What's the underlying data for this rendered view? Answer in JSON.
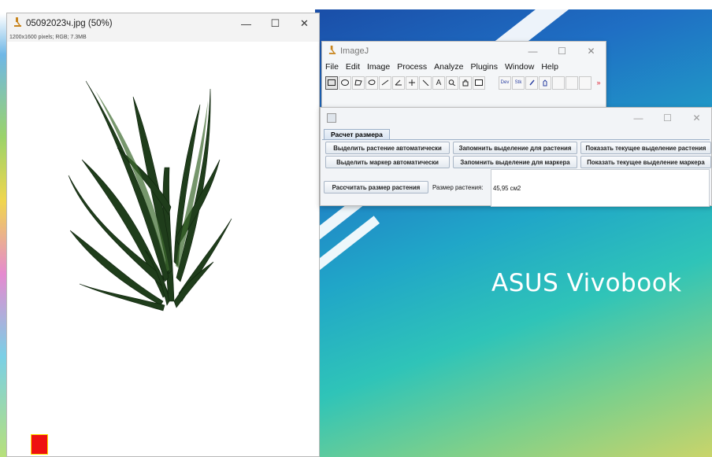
{
  "image_window": {
    "title": "05092023ч.jpg (50%)",
    "info": "1200x1600 pixels; RGB; 7.3MB",
    "controls": {
      "minimize": "—",
      "maximize": "☐",
      "close": "✕"
    }
  },
  "imagej": {
    "title": "ImageJ",
    "menu": [
      "File",
      "Edit",
      "Image",
      "Process",
      "Analyze",
      "Plugins",
      "Window",
      "Help"
    ],
    "controls": {
      "minimize": "—",
      "maximize": "☐",
      "close": "✕"
    }
  },
  "plugin": {
    "controls": {
      "minimize": "—",
      "maximize": "☐",
      "close": "✕"
    },
    "tab_label": "Расчет размера",
    "buttons": {
      "auto_plant": "Выделить растение автоматически",
      "save_plant": "Запомнить выделение для растения",
      "show_plant": "Показать текущее выделение растения",
      "auto_marker": "Выделить маркер автоматически",
      "save_marker": "Запомнить выделение для маркера",
      "show_marker": "Показать текущее выделение маркера",
      "calculate": "Рассчитать размер растения"
    },
    "size_label": "Размер растения:",
    "size_value": "45,95 см2"
  },
  "wallpaper": {
    "brand": "ASUS Vivobook"
  },
  "colors": {
    "marker": "#ee1111",
    "tab_border": "#9cb0c8",
    "plant_dark": "#1e3a1a"
  }
}
